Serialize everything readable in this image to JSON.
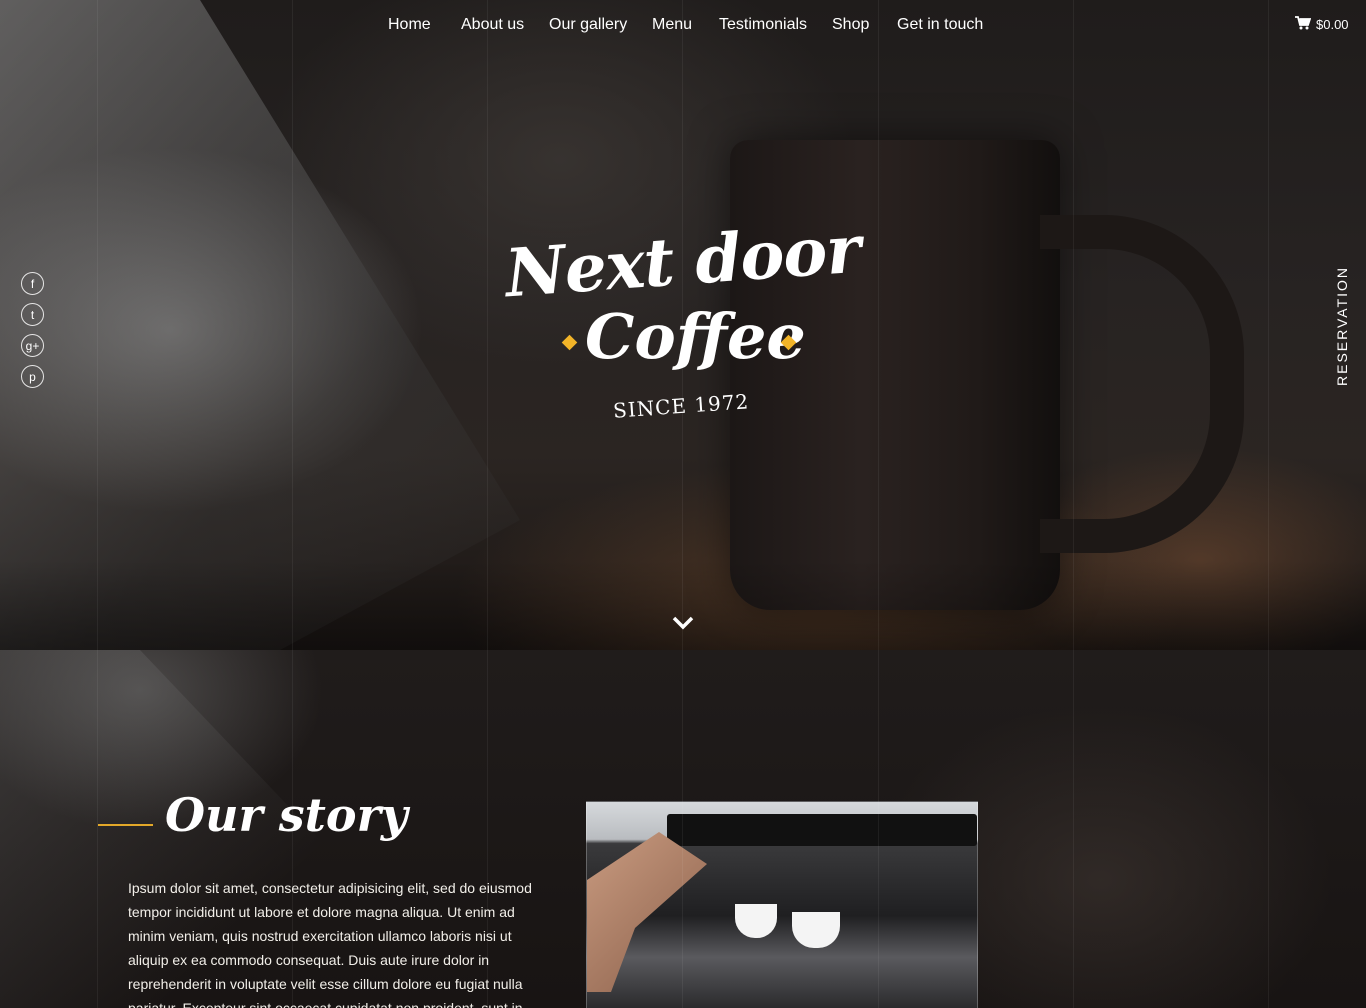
{
  "nav": {
    "items": [
      {
        "label": "Home"
      },
      {
        "label": "About us"
      },
      {
        "label": "Our gallery"
      },
      {
        "label": "Menu"
      },
      {
        "label": "Testimonials"
      },
      {
        "label": "Shop"
      },
      {
        "label": "Get in touch"
      }
    ],
    "cart_total": "$0.00"
  },
  "social": {
    "icons": [
      "facebook-icon",
      "twitter-icon",
      "google-plus-icon",
      "pinterest-icon"
    ],
    "glyphs": [
      "f",
      "t",
      "g+",
      "p"
    ]
  },
  "reservation_label": "RESERVATION",
  "logo": {
    "line1": "Next door",
    "line2": "Coffee",
    "since": "SINCE 1972",
    "accent_color": "#f2b428"
  },
  "story": {
    "title": "Our story",
    "body": "Ipsum dolor sit amet, consectetur adipisicing elit, sed do eiusmod tempor incididunt ut labore et dolore magna aliqua. Ut enim ad minim veniam, quis nostrud exercitation ullamco laboris nisi ut aliquip ex ea commodo consequat. Duis aute irure dolor in reprehenderit in voluptate velit esse cillum dolore eu fugiat nulla pariatur. Excepteur sint occaecat cupidatat non proident, sunt in culpa qui",
    "accent_color": "#e3a829"
  }
}
